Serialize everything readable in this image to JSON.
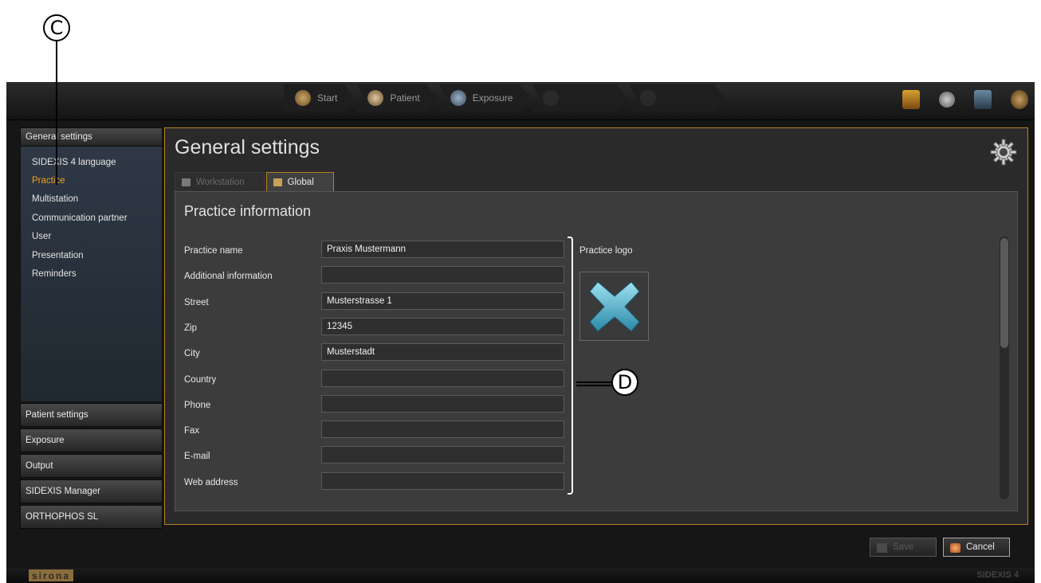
{
  "callouts": {
    "c": "C",
    "d": "D"
  },
  "workflow": {
    "steps": [
      {
        "label": "Start",
        "enabled": true
      },
      {
        "label": "Patient",
        "enabled": true
      },
      {
        "label": "Exposure",
        "enabled": true
      },
      {
        "label": "",
        "enabled": false
      },
      {
        "label": "",
        "enabled": false
      }
    ]
  },
  "top_icons": [
    "book-icon",
    "gear-icon",
    "monitor-icon",
    "user-icon"
  ],
  "sidebar": {
    "categories": [
      {
        "label": "General settings",
        "items": [
          {
            "label": "SIDEXIS 4 language",
            "active": false
          },
          {
            "label": "Practice",
            "active": true
          },
          {
            "label": "Multistation",
            "active": false
          },
          {
            "label": "Communication partner",
            "active": false
          },
          {
            "label": "User",
            "active": false
          },
          {
            "label": "Presentation",
            "active": false
          },
          {
            "label": "Reminders",
            "active": false
          }
        ]
      },
      {
        "label": "Patient settings"
      },
      {
        "label": "Exposure"
      },
      {
        "label": "Output"
      },
      {
        "label": "SIDEXIS Manager"
      },
      {
        "label": "ORTHOPHOS SL"
      }
    ]
  },
  "main": {
    "title": "General settings",
    "tabs": [
      {
        "label": "Workstation",
        "active": false
      },
      {
        "label": "Global",
        "active": true
      }
    ],
    "section_title": "Practice information",
    "fields": [
      {
        "label": "Practice name",
        "value": "Praxis Mustermann"
      },
      {
        "label": "Additional information",
        "value": ""
      },
      {
        "label": "Street",
        "value": "Musterstrasse 1"
      },
      {
        "label": "Zip",
        "value": "12345"
      },
      {
        "label": "City",
        "value": "Musterstadt"
      },
      {
        "label": "Country",
        "value": ""
      },
      {
        "label": "Phone",
        "value": ""
      },
      {
        "label": "Fax",
        "value": ""
      },
      {
        "label": "E-mail",
        "value": ""
      },
      {
        "label": "Web address",
        "value": ""
      }
    ],
    "logo_label": "Practice logo"
  },
  "buttons": {
    "save": "Save",
    "cancel": "Cancel"
  },
  "footer": {
    "brand": "sirona",
    "product": "SIDEXIS 4"
  },
  "colors": {
    "accent": "#f0a018",
    "frame": "#b78420",
    "logo_x": "#4ab0d0"
  }
}
